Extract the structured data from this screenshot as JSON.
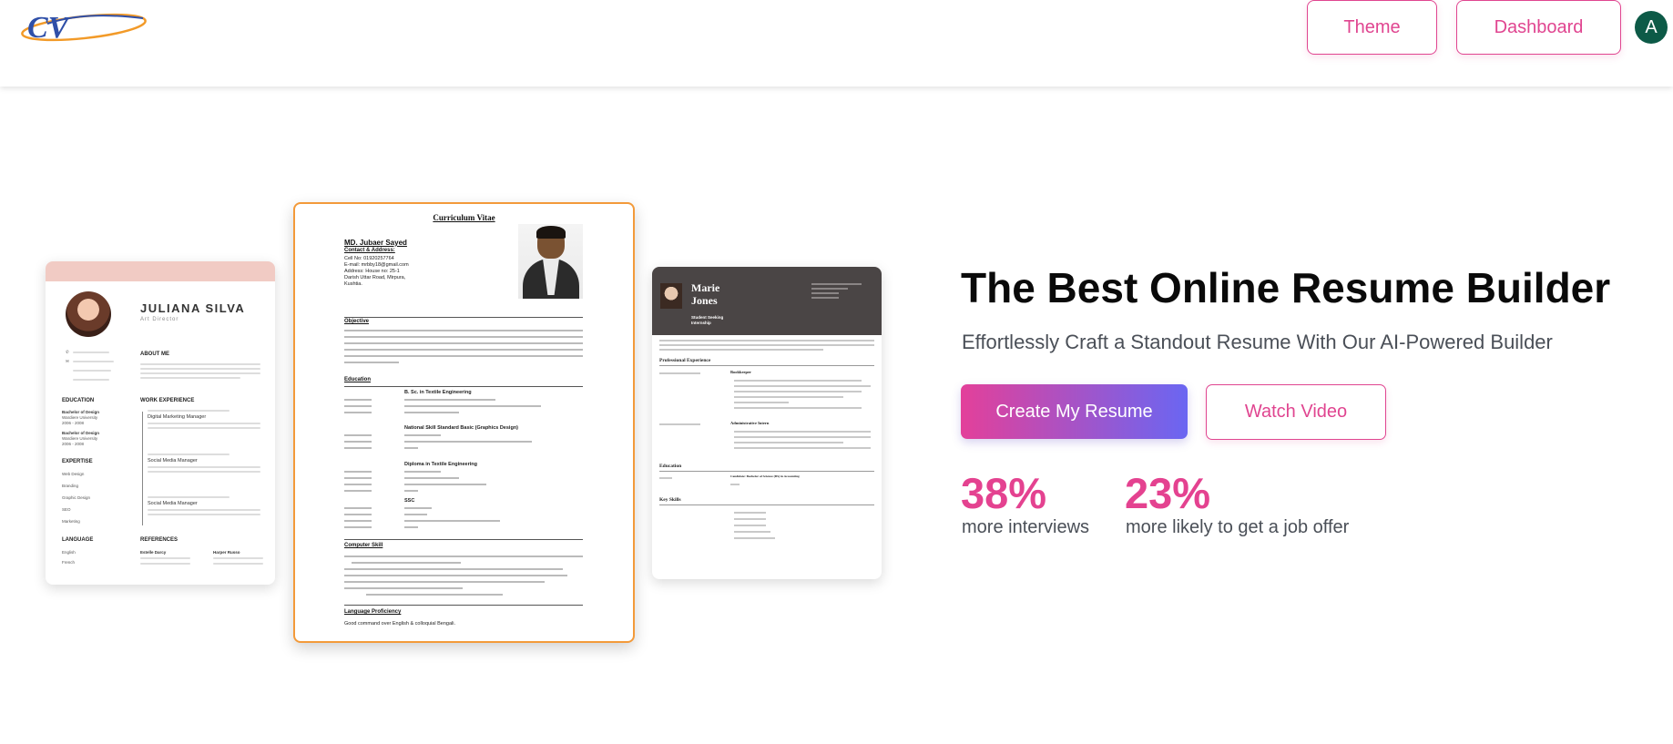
{
  "header": {
    "logo_text": "CV",
    "nav": {
      "theme_label": "Theme",
      "dashboard_label": "Dashboard"
    },
    "avatar_initial": "A"
  },
  "resumes": {
    "left": {
      "name": "JULIANA SILVA",
      "role": "Art Director",
      "about_heading": "ABOUT ME",
      "education_heading": "EDUCATION",
      "education_items": [
        "Bachelor of Design",
        "Wardiere University",
        "2006 - 2008",
        "Bachelor of Design",
        "Wardiere University",
        "2006 - 2008"
      ],
      "work_heading": "WORK EXPERIENCE",
      "jobs": [
        "Digital Marketing Manager",
        "Social Media Manager",
        "Social Media Manager"
      ],
      "expertise_heading": "EXPERTISE",
      "expertise_items": [
        "Web Design",
        "Branding",
        "Graphic Design",
        "SEO",
        "Marketing"
      ],
      "language_heading": "LANGUAGE",
      "languages": [
        "English",
        "French"
      ],
      "references_heading": "REFERENCES",
      "references": [
        "Estelle Darcy",
        "Harper Russo"
      ]
    },
    "middle": {
      "title": "Curriculum Vitae",
      "name": "MD. Jubaer Sayed",
      "contact_heading": "Contact & Address:",
      "contact_lines": [
        "Cell No: 01920257764",
        "E-mail: mrbby18@gmail.com",
        "Address: House no: 25-1",
        "Darish Uttar Road, Mirpura,",
        "Kushtia."
      ],
      "objective_heading": "Objective",
      "education_heading": "Education",
      "education_titles": [
        "B. Sc. in Textile Engineering",
        "National Skill Standard Basic (Graphics Design)",
        "Diploma in Textile Engineering",
        "SSC"
      ],
      "skill_heading": "Computer Skill",
      "language_heading": "Language Proficiency",
      "language_text": "Good command over English & colloquial Bengali."
    },
    "right": {
      "name_first": "Marie",
      "name_last": "Jones",
      "role_line1": "Student Seeking",
      "role_line2": "Internship",
      "experience_heading": "Professional Experience",
      "job1": "Bookkeeper",
      "job2": "Administrative Intern",
      "education_heading": "Education",
      "degree": "Candidate: Bachelor of Science (BS) in Accounting",
      "skills_heading": "Key Skills"
    }
  },
  "hero": {
    "title": "The Best Online Resume Builder",
    "subtitle": "Effortlessly Craft a Standout Resume With Our AI-Powered Builder",
    "create_label": "Create My Resume",
    "watch_label": "Watch Video"
  },
  "stats": [
    {
      "value": "38%",
      "label": "more interviews"
    },
    {
      "value": "23%",
      "label": "more likely to get a job offer"
    }
  ],
  "colors": {
    "accent": "#e44290",
    "gradient_start": "#e3409a",
    "gradient_end": "#6a66f2",
    "avatar_bg": "#0d5a47",
    "card_border": "#f39a3a"
  }
}
